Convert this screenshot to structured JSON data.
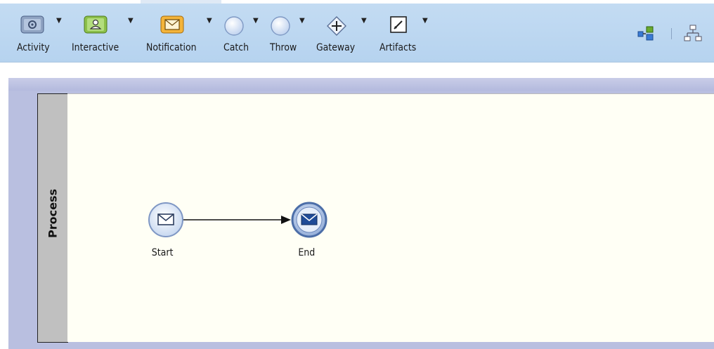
{
  "toolbar": {
    "tools": [
      {
        "id": "activity",
        "label": "Activity",
        "icon": "gear-icon"
      },
      {
        "id": "interactive",
        "label": "Interactive",
        "icon": "user-task-icon"
      },
      {
        "id": "notification",
        "label": "Notification",
        "icon": "envelope-icon"
      },
      {
        "id": "catch",
        "label": "Catch",
        "icon": "catch-event-icon"
      },
      {
        "id": "throw",
        "label": "Throw",
        "icon": "throw-event-icon"
      },
      {
        "id": "gateway",
        "label": "Gateway",
        "icon": "gateway-icon"
      },
      {
        "id": "artifacts",
        "label": "Artifacts",
        "icon": "annotation-icon"
      }
    ],
    "right_icons": [
      "connect-shapes-icon",
      "auto-layout-icon"
    ]
  },
  "lane": {
    "title": "Process"
  },
  "nodes": {
    "start": {
      "label": "Start",
      "icon": "message-start-event-icon"
    },
    "end": {
      "label": "End",
      "icon": "message-end-event-icon"
    }
  },
  "colors": {
    "toolbar_bg": "#b6d3ef",
    "canvas_bg": "#fffff5",
    "lane_header": "#c0c0c0",
    "event_blue": "#3a63a8",
    "event_fill": "#dbe8f7"
  }
}
